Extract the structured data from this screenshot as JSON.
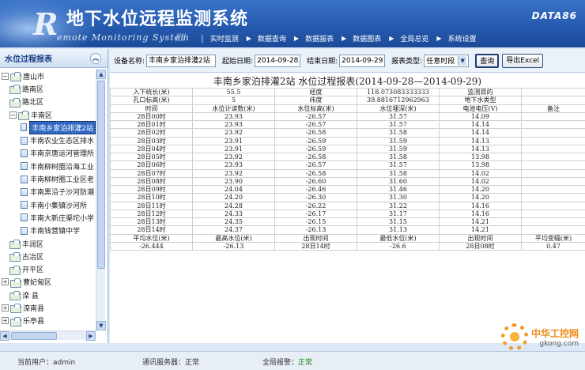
{
  "app": {
    "title": "地下水位远程监测系统",
    "subtitle": "emote Monitoring System",
    "logo_letter": "R",
    "brand": "DATA86"
  },
  "menu": {
    "items": [
      "实时监测",
      "数据查询",
      "数据报表",
      "数据图表",
      "全局总览",
      "系统设置"
    ]
  },
  "sidebar": {
    "title": "水位过程报表",
    "nodes": [
      {
        "label": "唐山市",
        "level": 0,
        "expander": "−",
        "type": "folder"
      },
      {
        "label": "路南区",
        "level": 1,
        "expander": "",
        "type": "folder"
      },
      {
        "label": "路北区",
        "level": 1,
        "expander": "",
        "type": "folder"
      },
      {
        "label": "丰南区",
        "level": 1,
        "expander": "−",
        "type": "folder"
      },
      {
        "label": "丰南乡家泊排灌2站",
        "level": 2,
        "expander": "",
        "type": "station",
        "selected": true
      },
      {
        "label": "丰南农业生态区排水",
        "level": 2,
        "expander": "",
        "type": "station"
      },
      {
        "label": "丰南京唐运河管理所",
        "level": 2,
        "expander": "",
        "type": "station"
      },
      {
        "label": "丰南柳树圈沿海工业",
        "level": 2,
        "expander": "",
        "type": "station"
      },
      {
        "label": "丰南柳树圈工业区老",
        "level": 2,
        "expander": "",
        "type": "station"
      },
      {
        "label": "丰南黑沿子沙河防潮",
        "level": 2,
        "expander": "",
        "type": "station"
      },
      {
        "label": "丰南小集镇沙河所",
        "level": 2,
        "expander": "",
        "type": "station"
      },
      {
        "label": "丰南大新庄渠坨小学",
        "level": 2,
        "expander": "",
        "type": "station"
      },
      {
        "label": "丰南钱营镇中学",
        "level": 2,
        "expander": "",
        "type": "station"
      },
      {
        "label": "丰润区",
        "level": 1,
        "expander": "",
        "type": "folder"
      },
      {
        "label": "古冶区",
        "level": 1,
        "expander": "",
        "type": "folder"
      },
      {
        "label": "开平区",
        "level": 1,
        "expander": "",
        "type": "folder"
      },
      {
        "label": "曹妃甸区",
        "level": 0,
        "expander": "+",
        "type": "folder"
      },
      {
        "label": "滦 县",
        "level": 1,
        "expander": "",
        "type": "folder"
      },
      {
        "label": "滦南县",
        "level": 0,
        "expander": "+",
        "type": "folder"
      },
      {
        "label": "乐亭县",
        "level": 0,
        "expander": "+",
        "type": "folder"
      }
    ]
  },
  "toolbar": {
    "device_label": "设备名称:",
    "device_value": "丰南乡家泊排灌2站",
    "start_label": "起始日期:",
    "start_value": "2014-09-28",
    "end_label": "结束日期:",
    "end_value": "2014-09-29",
    "type_label": "报表类型:",
    "type_value": "任意时段",
    "query_button": "查询",
    "export_button": "导出Excel"
  },
  "report": {
    "title": "丰南乡家泊排灌2站  水位过程报表(2014-09-28—2014-09-29)",
    "info_rows": [
      [
        "入下统长(米)",
        "55.5",
        "经度",
        "118.073083333333",
        "监测目的",
        ""
      ],
      [
        "孔口标高(米)",
        "5",
        "纬度",
        "39.8816712962963",
        "地下水类型",
        ""
      ]
    ],
    "headers": [
      "时间",
      "水位计读数(米)",
      "水位标高(米)",
      "水位埋深(米)",
      "电池电压(V)",
      "备注"
    ],
    "rows": [
      [
        "28日00时",
        "23.93",
        "-26.57",
        "31.57",
        "14.09",
        ""
      ],
      [
        "28日01时",
        "23.93",
        "-26.57",
        "31.57",
        "14.14",
        ""
      ],
      [
        "28日02时",
        "23.92",
        "-26.58",
        "31.58",
        "14.14",
        ""
      ],
      [
        "28日03时",
        "23.91",
        "-26.59",
        "31.59",
        "14.13",
        ""
      ],
      [
        "28日04时",
        "23.91",
        "-26.59",
        "31.59",
        "14.13",
        ""
      ],
      [
        "28日05时",
        "23.92",
        "-26.58",
        "31.58",
        "13.98",
        ""
      ],
      [
        "28日06时",
        "23.93",
        "-26.57",
        "31.57",
        "13.98",
        ""
      ],
      [
        "28日07时",
        "23.92",
        "-26.58",
        "31.58",
        "14.02",
        ""
      ],
      [
        "28日08时",
        "23.90",
        "-26.60",
        "31.60",
        "14.02",
        ""
      ],
      [
        "28日09时",
        "24.04",
        "-26.46",
        "31.46",
        "14.20",
        ""
      ],
      [
        "28日10时",
        "24.20",
        "-26.30",
        "31.30",
        "14.20",
        ""
      ],
      [
        "28日11时",
        "24.28",
        "-26.22",
        "31.22",
        "14.16",
        ""
      ],
      [
        "28日12时",
        "24.33",
        "-26.17",
        "31.17",
        "14.16",
        ""
      ],
      [
        "28日13时",
        "24.35",
        "-26.15",
        "31.15",
        "14.21",
        ""
      ],
      [
        "28日14时",
        "24.37",
        "-26.13",
        "31.13",
        "14.21",
        ""
      ]
    ],
    "summary_headers": [
      "平均水位(米)",
      "最高水位(米)",
      "出现时间",
      "最低水位(米)",
      "出现时间",
      "平均变幅(米)"
    ],
    "summary_values": [
      "-26.444",
      "-26.13",
      "28日14时",
      "-26.6",
      "28日08时",
      "0.47"
    ]
  },
  "status": {
    "user_label": "当前用户：",
    "user_value": "admin",
    "server_label": "通讯服务器：",
    "server_value": "正常",
    "alarm_label": "全局报警：",
    "alarm_value": "正常"
  },
  "watermark": {
    "line1": "中华工控网",
    "line2": "gkong.com"
  },
  "colors": {
    "header_blue": "#2458ad",
    "ok_green": "#0a8a0a",
    "selection": "#316ac5"
  }
}
